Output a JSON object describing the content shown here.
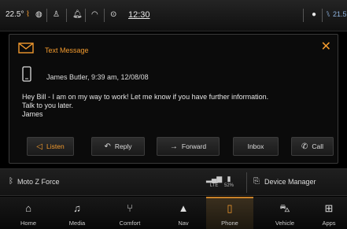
{
  "status": {
    "temp_left": "22.5°",
    "time": "12:30",
    "temp_right": "21.5"
  },
  "message": {
    "title": "Text Message",
    "sender_line": "James Butler, 9:39 am, 12/08/08",
    "body_line1": "Hey Bill - I am on my way to work! Let me know if you have further information.",
    "body_line2": "Talk to you later.",
    "body_line3": "James",
    "actions": {
      "listen": "Listen",
      "reply": "Reply",
      "forward": "Forward",
      "inbox": "Inbox",
      "call": "Call"
    }
  },
  "device": {
    "name": "Moto Z Force",
    "signal_label": "LTE",
    "battery_label": "52%",
    "manager": "Device Manager"
  },
  "nav": {
    "home": "Home",
    "media": "Media",
    "comfort": "Comfort",
    "nav": "Nav",
    "phone": "Phone",
    "vehicle": "Vehicle",
    "apps": "Apps"
  },
  "colors": {
    "accent": "#f29a2e",
    "background": "#000000"
  }
}
